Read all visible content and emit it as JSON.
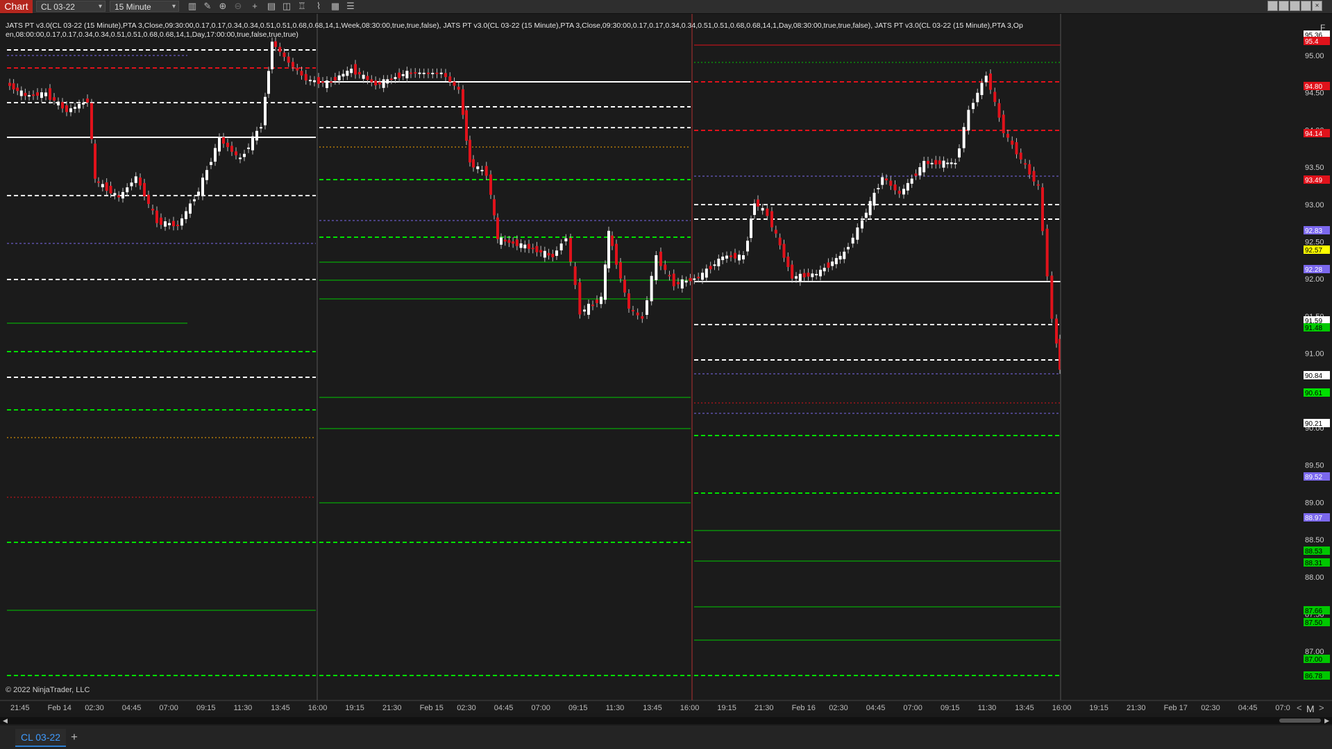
{
  "app": {
    "title": "Chart",
    "instrument": "CL 03-22",
    "interval": "15 Minute"
  },
  "toolbar": {
    "icons": [
      "bar-type-icon",
      "draw-pencil-icon",
      "zoom-in-icon",
      "zoom-out-icon",
      "crosshair-icon",
      "data-box-icon",
      "properties-icon",
      "strategies-icon",
      "indicators-icon",
      "calculator-icon",
      "list-icon"
    ],
    "window_buttons": [
      "minimize-icon",
      "restore-icon",
      "maximize-icon",
      "close-icon"
    ]
  },
  "chart": {
    "indicator_label": "JATS PT v3.0(CL 03-22 (15 Minute),PTA 3,Close,09:30:00,0.17,0.17,0.34,0.34,0.51,0.51,0.68,0.68,14,1,Week,08:30:00,true,true,false), JATS PT v3.0(CL 03-22 (15 Minute),PTA 3,Close,09:30:00,0.17,0.17,0.34,0.34,0.51,0.51,0.68,0.68,14,1,Day,08:30:00,true,true,false), JATS PT v3.0(CL 03-22 (15 Minute),PTA 3,Open,08:00:00,0.17,0.17,0.34,0.34,0.51,0.51,0.68,0.68,14,1,Day,17:00:00,true,false,true,true)",
    "copyright": "© 2022 NinjaTrader, LLC",
    "mode": "M",
    "f_label": "F",
    "price_ticks": [
      "95.00",
      "94.50",
      "94.00",
      "93.50",
      "93.00",
      "92.50",
      "92.00",
      "91.50",
      "91.00",
      "90.50",
      "90.00",
      "89.50",
      "89.00",
      "88.50",
      "88.00",
      "87.50",
      "87.00"
    ],
    "time_ticks": [
      "21:45",
      "Feb 14",
      "02:30",
      "04:45",
      "07:00",
      "09:15",
      "11:30",
      "13:45",
      "16:00",
      "19:15",
      "21:30",
      "Feb 15",
      "02:30",
      "04:45",
      "07:00",
      "09:15",
      "11:30",
      "13:45",
      "16:00",
      "19:15",
      "21:30",
      "Feb 16",
      "02:30",
      "04:45",
      "07:00",
      "09:15",
      "11:30",
      "13:45",
      "16:00",
      "19:15",
      "21:30",
      "Feb 17",
      "02:30",
      "04:45",
      "07:0"
    ],
    "price_labels": [
      {
        "text": "95.36",
        "bg": "#ffffff",
        "fg": "#000000"
      },
      {
        "text": "95.4",
        "bg": "#e0121b",
        "fg": "#ffffff"
      },
      {
        "text": "94.80",
        "bg": "#e0121b",
        "fg": "#ffffff"
      },
      {
        "text": "94.14",
        "bg": "#e0121b",
        "fg": "#ffffff"
      },
      {
        "text": "93.49",
        "bg": "#e0121b",
        "fg": "#ffffff"
      },
      {
        "text": "92.83",
        "bg": "#7b68ee",
        "fg": "#ffffff"
      },
      {
        "text": "92.57",
        "bg": "#ffff00",
        "fg": "#000000"
      },
      {
        "text": "92.28",
        "bg": "#7b68ee",
        "fg": "#ffffff"
      },
      {
        "text": "91.59",
        "bg": "#ffffff",
        "fg": "#000000"
      },
      {
        "text": "91.48",
        "bg": "#00c800",
        "fg": "#000000"
      },
      {
        "text": "90.84",
        "bg": "#ffffff",
        "fg": "#000000"
      },
      {
        "text": "90.61",
        "bg": "#00e000",
        "fg": "#000000"
      },
      {
        "text": "90.21",
        "bg": "#ffffff",
        "fg": "#000000"
      },
      {
        "text": "89.52",
        "bg": "#7b68ee",
        "fg": "#ffffff"
      },
      {
        "text": "88.97",
        "bg": "#7b68ee",
        "fg": "#ffffff"
      },
      {
        "text": "88.53",
        "bg": "#00c800",
        "fg": "#000000"
      },
      {
        "text": "88.31",
        "bg": "#00c800",
        "fg": "#000000"
      },
      {
        "text": "87.66",
        "bg": "#00c800",
        "fg": "#000000"
      },
      {
        "text": "87.50",
        "bg": "#00c800",
        "fg": "#000000"
      },
      {
        "text": "87.00",
        "bg": "#00c800",
        "fg": "#000000"
      },
      {
        "text": "86.78",
        "bg": "#00c800",
        "fg": "#000000"
      }
    ]
  },
  "bottom": {
    "tab_label": "CL 03-22",
    "add_tab": "+"
  },
  "colors": {
    "background": "#1b1b1b",
    "up_candle": "#ffffff",
    "down_candle": "#e0121b",
    "support": "#00c800",
    "resistance": "#e0121b",
    "pivot": "#7b68ee"
  }
}
